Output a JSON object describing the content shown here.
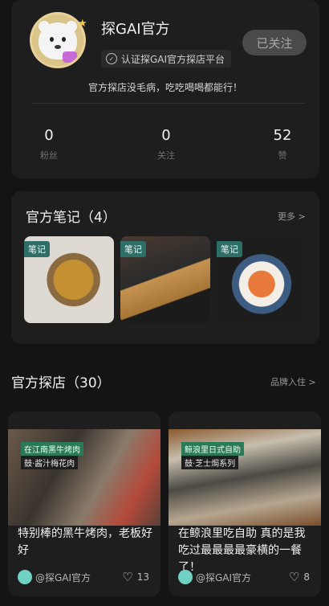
{
  "profile": {
    "name": "探GAI官方",
    "verified_text": "认证探GAI官方探店平台",
    "follow_button": "已关注",
    "description": "官方探店没毛病，吃吃喝喝都能行！",
    "stats": [
      {
        "num": "0",
        "label": "粉丝"
      },
      {
        "num": "0",
        "label": "关注"
      },
      {
        "num": "52",
        "label": "赞"
      }
    ]
  },
  "notes_section": {
    "title": "官方笔记（4）",
    "more": "更多 >",
    "thumbs": [
      {
        "tag": "笔记"
      },
      {
        "tag": "笔记"
      },
      {
        "tag": "笔记"
      }
    ]
  },
  "shops_section": {
    "title": "官方探店（30）",
    "more": "品牌入住 >",
    "cards": [
      {
        "label1": "在江南黑牛烤肉",
        "label2": "鼓·酱汁梅花肉",
        "title": "特别棒的黑牛烤肉，老板好好",
        "author": "@探GAI官方",
        "likes": "13"
      },
      {
        "label1": "鲸浪里日式自助",
        "label2": "鼓·芝士焗系列",
        "title": "在鲸浪里吃自助 真的是我吃过最最最最豪横的一餐了！",
        "author": "@探GAI官方",
        "likes": "8"
      }
    ]
  },
  "colors": {
    "tag_green": "#2d6e66",
    "shop_label_green": "#2a7a57",
    "card_bg": "#1e1e1e"
  }
}
